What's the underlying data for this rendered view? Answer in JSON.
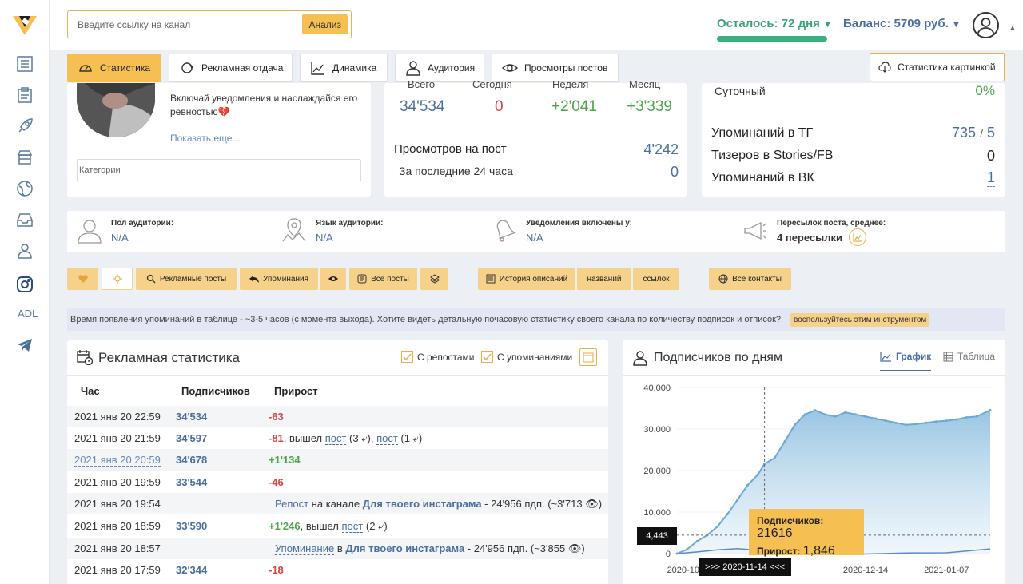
{
  "topbar": {
    "search_placeholder": "Введите ссылку на канал",
    "analyze_label": "Анализ",
    "remaining": "Осталось: 72 дня",
    "balance": "Баланс: 5709 руб.",
    "remaining_fraction": 1.0
  },
  "sidebar": {
    "adl_label": "ADL"
  },
  "tabs": [
    {
      "label": "Статистика",
      "active": true
    },
    {
      "label": "Рекламная отдача"
    },
    {
      "label": "Динамика"
    },
    {
      "label": "Аудитория"
    },
    {
      "label": "Просмотры постов"
    }
  ],
  "tab_right": "Статистика картинкой",
  "channel": {
    "description": "Включай уведомления и наслаждайся его ревностью💔",
    "show_more": "Показать еще...",
    "categories_placeholder": "Категории"
  },
  "stats_mid": {
    "headers": [
      "Всего",
      "Сегодня",
      "Неделя",
      "Месяц"
    ],
    "total": "34'534",
    "today": "0",
    "week": "+2'041",
    "month": "+3'339",
    "views_label": "Просмотров на пост",
    "views_value": "4'242",
    "last24_label": "За последние 24 часа",
    "last24_value": "0"
  },
  "stats_right": {
    "daily_label": "Суточный",
    "daily_value": "0%",
    "tg_label": "Упоминаний в ТГ",
    "tg_value": "735",
    "tg_value2": "5",
    "teasers_label": "Тизеров в Stories/FB",
    "teasers_value": "0",
    "vk_label": "Упоминаний в ВК",
    "vk_value": "1"
  },
  "audience": [
    {
      "label": "Пол аудитории:",
      "value": "N/A"
    },
    {
      "label": "Язык аудитории:",
      "value": "N/A"
    },
    {
      "label": "Уведомления включены у:",
      "value": "N/A"
    },
    {
      "label": "Пересылок поста, среднее:",
      "value": "4 пересылки"
    }
  ],
  "filters": {
    "ad_posts": "Рекламные посты",
    "mentions": "Упоминания",
    "all_posts": "Все посты",
    "desc_history": "История описаний",
    "names": "названий",
    "links": "ссылок",
    "all_contacts": "Все контакты"
  },
  "info": {
    "text": "Время появления упоминаний в таблице - ~3-5 часов (с момента выхода). Хотите видеть детальную почасовую статистику своего канала по количеству подписок и отписок?",
    "button": "воспользуйтесь этим инструментом"
  },
  "ad_stats": {
    "title": "Рекламная статистика",
    "with_reposts": "С репостами",
    "with_mentions": "С упоминаниями",
    "col_hour": "Час",
    "col_subs": "Подписчиков",
    "col_growth": "Прирост",
    "rows": [
      {
        "time": "2021 янв 20 22:59",
        "subs": "34'534",
        "growth": "-63",
        "kind": "neg"
      },
      {
        "time": "2021 янв 20 21:59",
        "subs": "34'597",
        "growth": "-81",
        "kind": "neg",
        "extra": ", вышел ",
        "link1": "пост",
        "n1": " (3 ",
        "sep": "), ",
        "link2": "пост",
        "n2": " (1 ",
        "end": ")"
      },
      {
        "time": "2021 янв 20 20:59",
        "subs": "34'678",
        "growth": "+1'134",
        "kind": "pos",
        "time_link": true
      },
      {
        "time": "2021 янв 20 19:59",
        "subs": "33'544",
        "growth": "-46",
        "kind": "neg"
      },
      {
        "time": "2021 янв 20 19:54",
        "repost": "Репост",
        "on_channel": " на канале ",
        "channel": "Для твоего инстаграма",
        "info": " - 24'956 пдп. (~3'713 "
      },
      {
        "time": "2021 янв 20 18:59",
        "subs": "33'590",
        "growth": "+1'246",
        "kind": "pos",
        "extra": ", вышел ",
        "link1": "пост",
        "n1": " (2 ",
        "end": ")"
      },
      {
        "time": "2021 янв 20 18:57",
        "repost": "Упоминание",
        "on_channel": " в ",
        "channel": "Для твоего инстаграма",
        "info": " - 24'956 пдп. (~3'855 "
      },
      {
        "time": "2021 янв 20 17:59",
        "subs": "32'344",
        "growth": "-18",
        "kind": "neg"
      }
    ]
  },
  "chart_panel": {
    "title": "Подписчиков по дням",
    "tab_chart": "График",
    "tab_table": "Таблица",
    "tooltip_subs_label": "Подписчиков",
    "tooltip_subs_value": "21616",
    "tooltip_growth_label": "Прирост",
    "tooltip_growth_value": "1,846",
    "y_marker": "4,443",
    "x_marker": ">>> 2020-11-14 <<<"
  },
  "chart_data": {
    "type": "area",
    "title": "Подписчиков по дням",
    "ylim": [
      0,
      40000
    ],
    "yticks": [
      "0",
      "10,000",
      "20,000",
      "30,000",
      "40,000"
    ],
    "xticks": [
      "2020-10-2",
      "2020-12-14",
      "2021-01-07"
    ],
    "series": [
      {
        "name": "Подписчиков",
        "x": [
          "2020-10-19",
          "2020-10-22",
          "2020-10-25",
          "2020-10-28",
          "2020-10-31",
          "2020-11-03",
          "2020-11-06",
          "2020-11-09",
          "2020-11-12",
          "2020-11-14",
          "2020-11-17",
          "2020-11-20",
          "2020-11-23",
          "2020-11-26",
          "2020-11-29",
          "2020-12-02",
          "2020-12-05",
          "2020-12-08",
          "2020-12-11",
          "2020-12-14",
          "2020-12-17",
          "2020-12-20",
          "2020-12-23",
          "2020-12-26",
          "2020-12-29",
          "2021-01-01",
          "2021-01-04",
          "2021-01-07",
          "2021-01-10",
          "2021-01-13",
          "2021-01-16",
          "2021-01-20"
        ],
        "values": [
          0,
          1000,
          3000,
          4443,
          6500,
          9500,
          13000,
          16500,
          19000,
          21616,
          23000,
          27000,
          31000,
          33500,
          34500,
          33500,
          33000,
          34000,
          33500,
          33000,
          32500,
          32000,
          31500,
          31000,
          31200,
          31500,
          31800,
          32000,
          32300,
          32800,
          33000,
          34534
        ]
      },
      {
        "name": "Прирост",
        "x": [
          "2020-10-19",
          "2020-10-25",
          "2020-10-31",
          "2020-11-06",
          "2020-11-12",
          "2020-11-14",
          "2020-11-20",
          "2020-11-26",
          "2020-12-02",
          "2020-12-14",
          "2020-12-26",
          "2021-01-07",
          "2021-01-20"
        ],
        "values": [
          0,
          400,
          900,
          1200,
          800,
          1846,
          700,
          500,
          200,
          -100,
          150,
          200,
          1134
        ]
      }
    ]
  }
}
